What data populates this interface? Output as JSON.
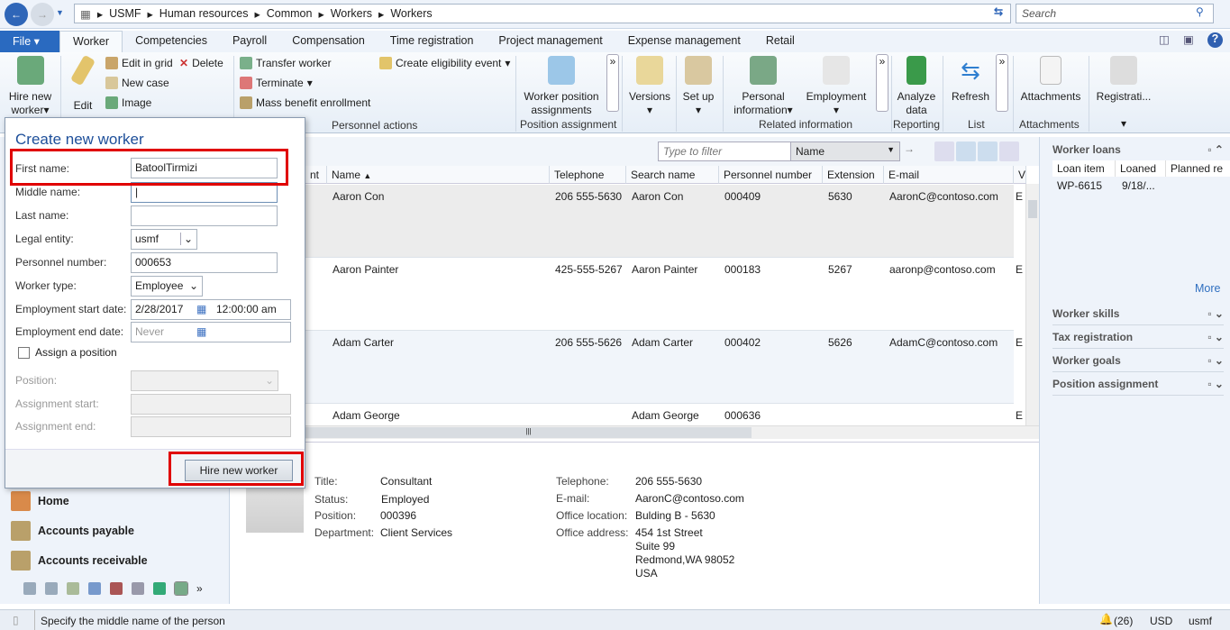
{
  "breadcrumb": [
    "USMF",
    "Human resources",
    "Common",
    "Workers",
    "Workers"
  ],
  "search": {
    "placeholder": "Search"
  },
  "tabs": [
    "File",
    "Worker",
    "Competencies",
    "Payroll",
    "Compensation",
    "Time registration",
    "Project management",
    "Expense management",
    "Retail"
  ],
  "ribbon": {
    "hire": "Hire new",
    "hire2": "worker",
    "edit": "Edit",
    "edit_grid": "Edit in grid",
    "delete": "Delete",
    "new_case": "New case",
    "image": "Image",
    "transfer": "Transfer worker",
    "terminate": "Terminate",
    "mass": "Mass benefit enrollment",
    "eligibility": "Create eligibility event",
    "personnel_actions": "Personnel actions",
    "wpa1": "Worker position",
    "wpa2": "assignments",
    "position_assignment": "Position assignment",
    "versions": "Versions",
    "setup": "Set up",
    "personal1": "Personal",
    "personal2": "information",
    "employment": "Employment",
    "related": "Related information",
    "analyze1": "Analyze",
    "analyze2": "data",
    "reporting": "Reporting",
    "refresh": "Refresh",
    "list": "List",
    "attachments": "Attachments",
    "attachments_group": "Attachments",
    "registration": "Registrati..."
  },
  "filter": {
    "placeholder": "Type to filter",
    "field": "Name"
  },
  "grid": {
    "headers": [
      "nt",
      "Name",
      "Telephone",
      "Search name",
      "Personnel number",
      "Extension",
      "E-mail",
      "V"
    ],
    "rows": [
      [
        "Aaron Con",
        "206 555-5630",
        "Aaron Con",
        "000409",
        "5630",
        "AaronC@contoso.com",
        "E"
      ],
      [
        "Aaron Painter",
        "425-555-5267",
        "Aaron Painter",
        "000183",
        "5267",
        "aaronp@contoso.com",
        "E"
      ],
      [
        "Adam Carter",
        "206 555-5626",
        "Adam Carter",
        "000402",
        "5626",
        "AdamC@contoso.com",
        "E"
      ],
      [
        "Adam George",
        "",
        "Adam George",
        "000636",
        "",
        "",
        "E"
      ]
    ]
  },
  "detail": {
    "title_l": "Title:",
    "title": "Consultant",
    "status_l": "Status:",
    "status": "Employed",
    "position_l": "Position:",
    "position": "000396",
    "dept_l": "Department:",
    "dept": "Client Services",
    "tel_l": "Telephone:",
    "tel": "206 555-5630",
    "email_l": "E-mail:",
    "email": "AaronC@contoso.com",
    "office_l": "Office location:",
    "office": "Bulding B - 5630",
    "addr_l": "Office address:",
    "addr": [
      "454 1st Street",
      "Suite 99",
      "Redmond,WA 98052",
      "USA"
    ]
  },
  "factboxes": {
    "loans": "Worker loans",
    "loan_cols": [
      "Loan item",
      "Loaned",
      "Planned re"
    ],
    "loan_row": [
      "WP-6615",
      "9/18/..."
    ],
    "more": "More",
    "others": [
      "Worker skills",
      "Tax registration",
      "Worker goals",
      "Position assignment"
    ]
  },
  "nav": [
    "Home",
    "Accounts payable",
    "Accounts receivable"
  ],
  "dialog": {
    "title": "Create new worker",
    "first_l": "First name:",
    "first": "BatoolTirmizi",
    "middle_l": "Middle name:",
    "last_l": "Last name:",
    "legal_l": "Legal entity:",
    "legal": "usmf",
    "pn_l": "Personnel number:",
    "pn": "000653",
    "wt_l": "Worker type:",
    "wt": "Employee",
    "start_l": "Employment start date:",
    "start": "2/28/2017",
    "start_time": "12:00:00 am",
    "end_l": "Employment end date:",
    "end": "Never",
    "assign": "Assign a position",
    "pos_l": "Position:",
    "as_l": "Assignment start:",
    "ae_l": "Assignment end:",
    "button": "Hire new worker"
  },
  "status": {
    "message": "Specify the middle name of the person",
    "alerts": "(26)",
    "currency": "USD",
    "company": "usmf"
  }
}
